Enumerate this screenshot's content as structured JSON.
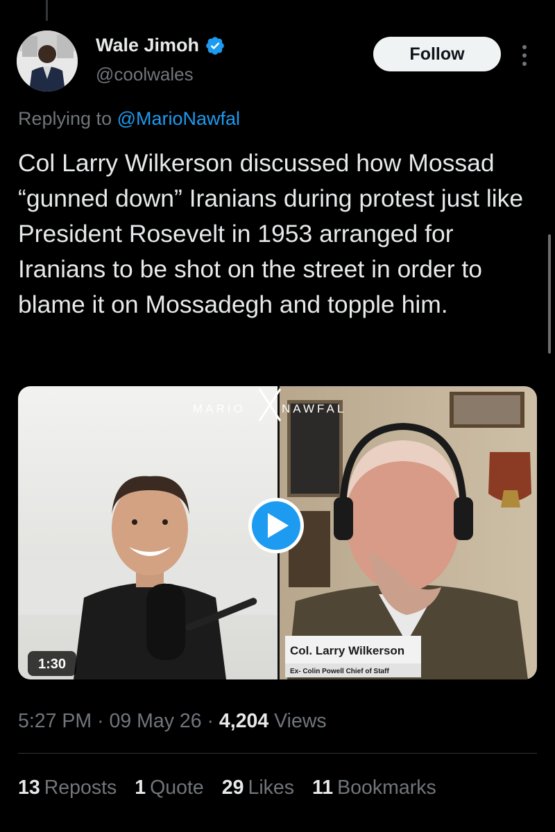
{
  "author": {
    "name": "Wale Jimoh",
    "handle": "@coolwales",
    "verified": true,
    "follow_label": "Follow"
  },
  "reply": {
    "prefix": "Replying to ",
    "to": "@MarioNawfal"
  },
  "tweet": {
    "text": "Col Larry Wilkerson discussed how Mossad “gunned down” Iranians during protest just like President Rosevelt in 1953 arranged for Iranians to be shot on the street in order to blame it on Mossadegh and topple him."
  },
  "video": {
    "watermark_left": "MARIO",
    "watermark_right": "NAWFAL",
    "duration": "1:30",
    "lower_third_name": "Col. Larry Wilkerson",
    "lower_third_title": "Ex- Colin Powell Chief of Staff"
  },
  "meta": {
    "time": "5:27 PM",
    "date": "09 May 26",
    "views_count": "4,204",
    "views_label": "Views",
    "sep": "·"
  },
  "stats": [
    {
      "count": "13",
      "label": "Reposts"
    },
    {
      "count": "1",
      "label": "Quote"
    },
    {
      "count": "29",
      "label": "Likes"
    },
    {
      "count": "11",
      "label": "Bookmarks"
    }
  ],
  "colors": {
    "background": "#000000",
    "text": "#e7e9ea",
    "secondary": "#71767b",
    "link": "#1d9bf0",
    "verified": "#1d9bf0"
  }
}
